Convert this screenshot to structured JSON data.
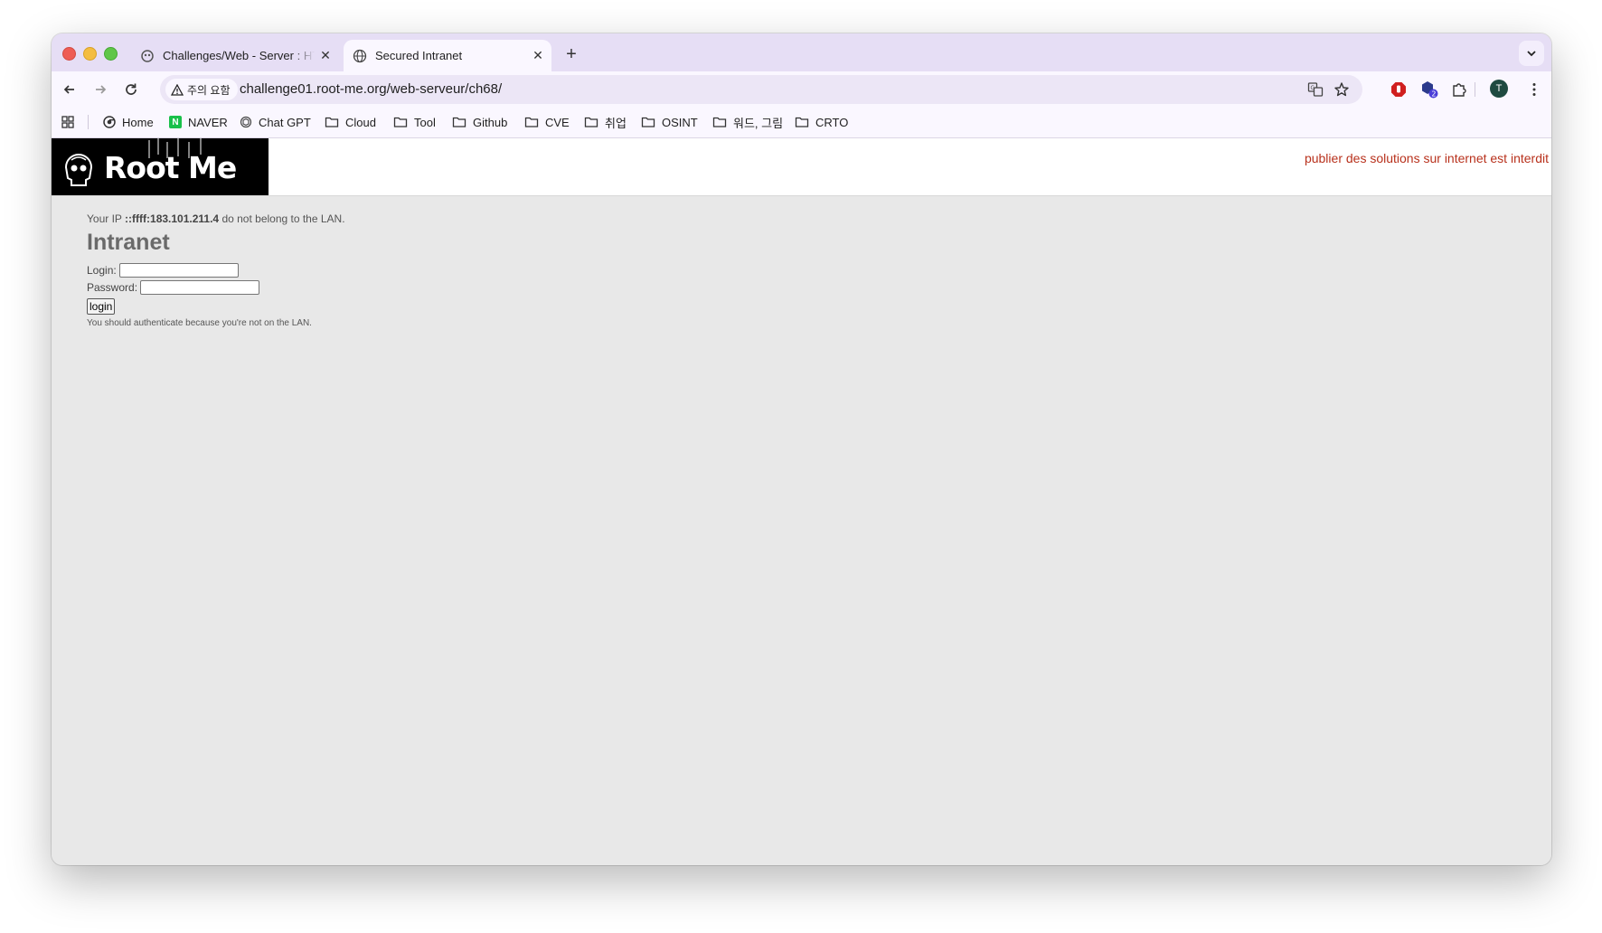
{
  "tabs": [
    {
      "title": "Challenges/Web - Server : HTTP - Headers",
      "favicon": "root-me-icon",
      "active": false
    },
    {
      "title": "Secured Intranet",
      "favicon": "globe-icon",
      "active": true
    }
  ],
  "toolbar": {
    "security_label": "주의 요함",
    "url": "challenge01.root-me.org/web-serveur/ch68/",
    "extension_badge": "2",
    "profile_initial": "T"
  },
  "bookmarks": [
    {
      "label": "Home",
      "icon": "chrome-icon"
    },
    {
      "label": "NAVER",
      "icon": "naver-icon"
    },
    {
      "label": "Chat GPT",
      "icon": "openai-icon"
    },
    {
      "label": "Cloud",
      "icon": "folder-icon"
    },
    {
      "label": "Tool",
      "icon": "folder-icon"
    },
    {
      "label": "Github",
      "icon": "folder-icon"
    },
    {
      "label": "CVE",
      "icon": "folder-icon"
    },
    {
      "label": "취업",
      "icon": "folder-icon"
    },
    {
      "label": "OSINT",
      "icon": "folder-icon"
    },
    {
      "label": "워드, 그림",
      "icon": "folder-icon"
    },
    {
      "label": "CRTO",
      "icon": "folder-icon"
    }
  ],
  "naver_glyph": "N",
  "site": {
    "logo_text": "Root Me",
    "warning": "publier des solutions sur internet est interdit"
  },
  "page": {
    "ip_prefix": "Your IP ",
    "ip": "::ffff:183.101.211.4",
    "ip_suffix": " do not belong to the LAN.",
    "heading": "Intranet",
    "login_label": "Login:",
    "password_label": "Password:",
    "login_value": "",
    "password_value": "",
    "login_button": "login",
    "note": "You should authenticate because you're not on the LAN."
  },
  "colors": {
    "tabstrip": "#e6def5",
    "toolbar": "#faf7ff",
    "page_bg": "#e8e8e8",
    "warning": "#b8311c"
  }
}
